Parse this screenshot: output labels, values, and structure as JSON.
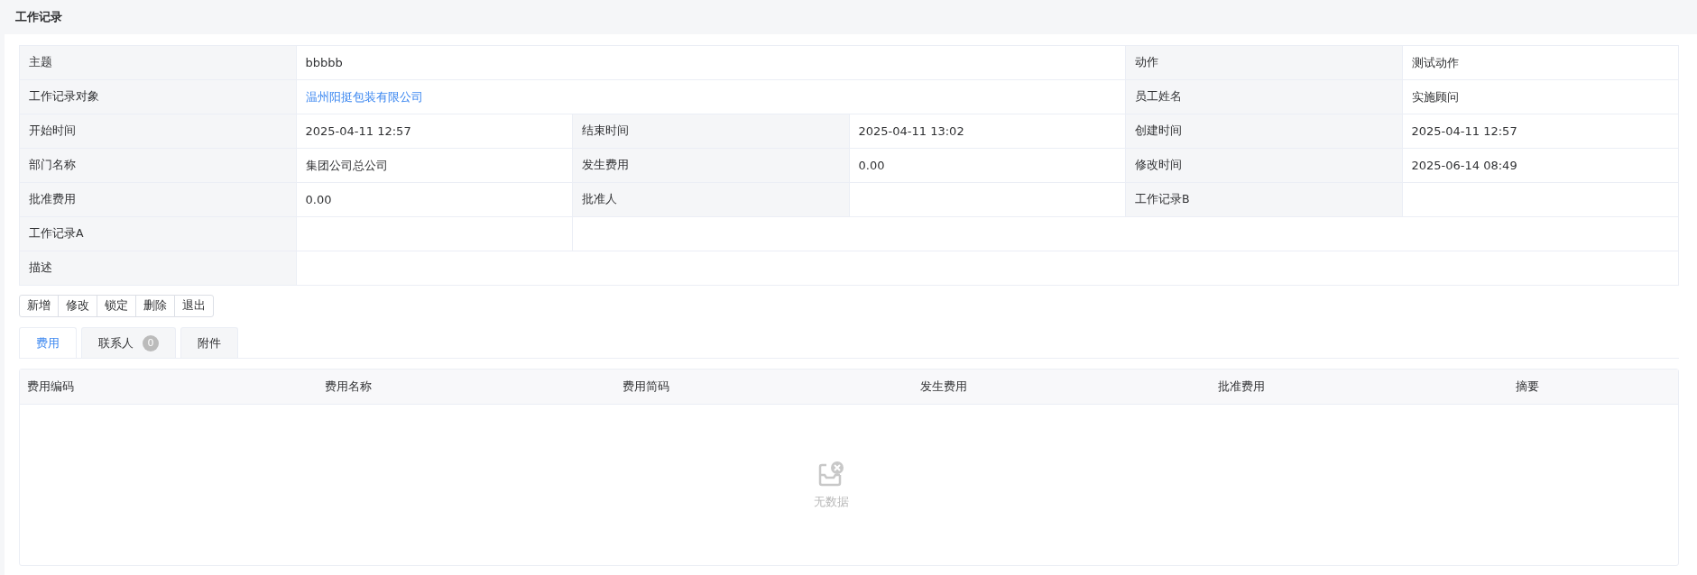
{
  "page": {
    "title": "工作记录"
  },
  "details": [
    [
      {
        "kind": "label",
        "text": "主题"
      },
      {
        "kind": "value",
        "text": "bbbbb"
      },
      {
        "kind": "label",
        "text": "动作"
      },
      {
        "kind": "value",
        "text": "测试动作"
      }
    ],
    [
      {
        "kind": "label",
        "text": "工作记录对象"
      },
      {
        "kind": "link",
        "text": "温州阳挺包装有限公司"
      },
      {
        "kind": "label",
        "text": "员工姓名"
      },
      {
        "kind": "value",
        "text": "实施顾问"
      }
    ],
    [
      {
        "kind": "label",
        "text": "开始时间"
      },
      {
        "kind": "value",
        "text": "2025-04-11 12:57"
      },
      {
        "kind": "label",
        "text": "结束时间"
      },
      {
        "kind": "value",
        "text": "2025-04-11 13:02"
      },
      {
        "kind": "label",
        "text": "创建时间"
      },
      {
        "kind": "value",
        "text": "2025-04-11 12:57"
      }
    ],
    [
      {
        "kind": "label",
        "text": "部门名称"
      },
      {
        "kind": "value",
        "text": "集团公司总公司"
      },
      {
        "kind": "label",
        "text": "发生费用"
      },
      {
        "kind": "value",
        "text": "0.00"
      },
      {
        "kind": "label",
        "text": "修改时间"
      },
      {
        "kind": "value",
        "text": "2025-06-14 08:49"
      }
    ],
    [
      {
        "kind": "label",
        "text": "批准费用"
      },
      {
        "kind": "value",
        "text": "0.00"
      },
      {
        "kind": "label",
        "text": "批准人"
      },
      {
        "kind": "value"
      },
      {
        "kind": "label",
        "text": "工作记录B"
      },
      {
        "kind": "value"
      }
    ],
    [
      {
        "kind": "label",
        "text": "工作记录A"
      },
      {
        "kind": "value"
      },
      {
        "kind": "value"
      }
    ],
    [
      {
        "kind": "label",
        "text": "描述"
      },
      {
        "kind": "value"
      }
    ]
  ],
  "actions": [
    "新增",
    "修改",
    "锁定",
    "删除",
    "退出"
  ],
  "tabs": [
    {
      "label": "费用",
      "selected": true
    },
    {
      "label": "联系人",
      "badge": "0",
      "selected": false
    },
    {
      "label": "附件",
      "selected": false
    }
  ],
  "table": {
    "columns": [
      "费用编码",
      "费用名称",
      "费用简码",
      "发生费用",
      "批准费用",
      "摘要"
    ],
    "empty_text": "无数据"
  }
}
